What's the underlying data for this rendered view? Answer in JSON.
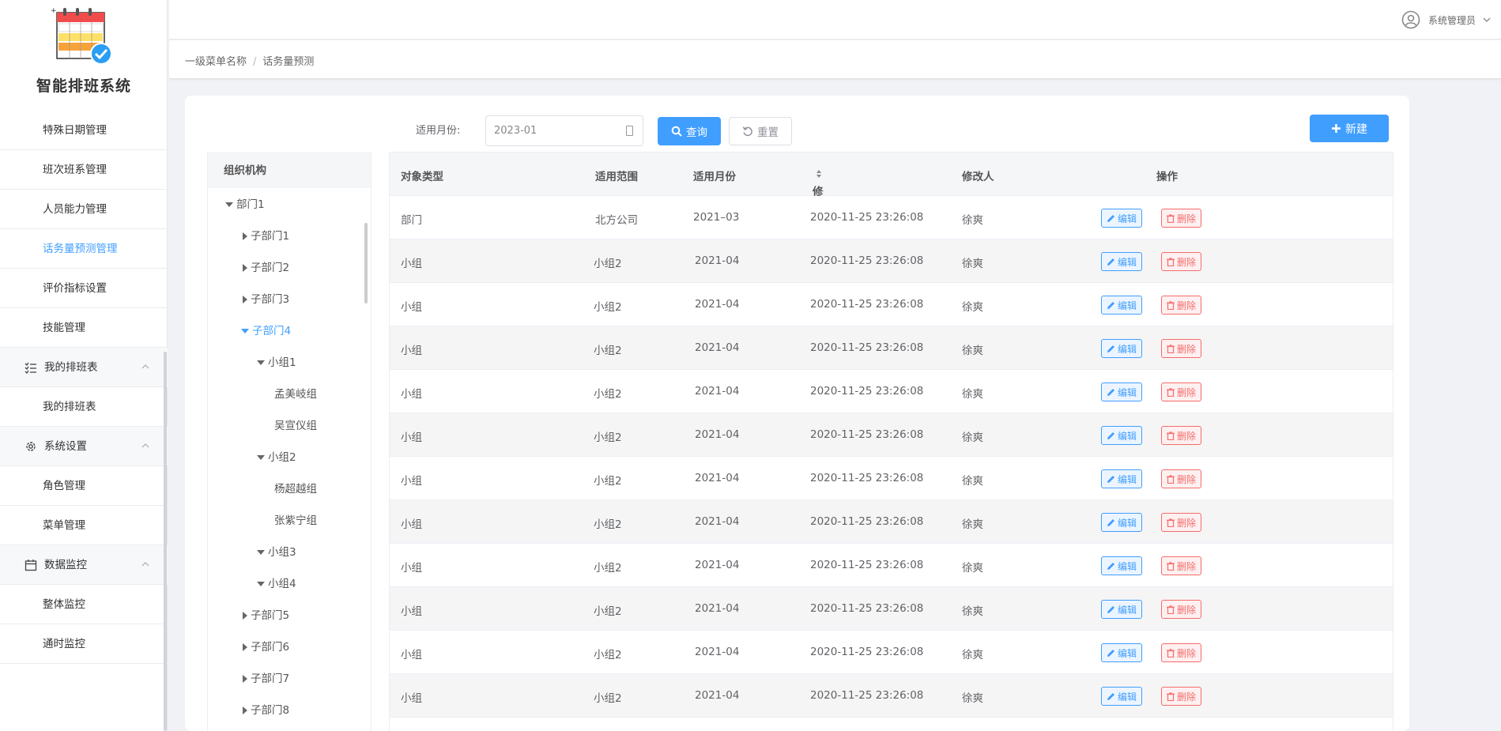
{
  "app": {
    "title": "智能排班系统"
  },
  "sidebar": {
    "items": [
      {
        "label": "特殊日期管理",
        "active": false
      },
      {
        "label": "班次班系管理",
        "active": false
      },
      {
        "label": "人员能力管理",
        "active": false
      },
      {
        "label": "话务量预测管理",
        "active": true
      },
      {
        "label": "评价指标设置",
        "active": false
      },
      {
        "label": "技能管理",
        "active": false
      }
    ],
    "groups": [
      {
        "label": "我的排班表",
        "icon": "list-check-icon",
        "children": [
          "我的排班表"
        ]
      },
      {
        "label": "系统设置",
        "icon": "gear-icon",
        "children": [
          "角色管理",
          "菜单管理"
        ]
      },
      {
        "label": "数据监控",
        "icon": "calendar-icon",
        "children": [
          "整体监控",
          "通时监控"
        ]
      }
    ]
  },
  "header": {
    "user_name": "系统管理员"
  },
  "breadcrumb": {
    "level1": "一级菜单名称",
    "separator": "/",
    "level2": "话务量预测"
  },
  "filter": {
    "month_label": "适用月份:",
    "month_value": "2023-01",
    "query_label": "查询",
    "reset_label": "重置",
    "new_label": "新建"
  },
  "tree": {
    "header": "组织机构",
    "nodes": [
      {
        "label": "部门1",
        "expanded": true
      },
      {
        "label": "子部门1"
      },
      {
        "label": "子部门2"
      },
      {
        "label": "子部门3"
      },
      {
        "label": "子部门4",
        "expanded": true,
        "active": true
      },
      {
        "label": "小组1",
        "expanded": true
      },
      {
        "label": "孟美岐组"
      },
      {
        "label": "吴宣仪组"
      },
      {
        "label": "小组2",
        "expanded": true
      },
      {
        "label": "杨超越组"
      },
      {
        "label": "张紫宁组"
      },
      {
        "label": "小组3",
        "expanded": true
      },
      {
        "label": "小组4",
        "expanded": true
      },
      {
        "label": "子部门5"
      },
      {
        "label": "子部门6"
      },
      {
        "label": "子部门7"
      },
      {
        "label": "子部门8"
      }
    ]
  },
  "table": {
    "columns": [
      "对象类型",
      "适用范围",
      "适用月份",
      "修改时间",
      "修改人",
      "操作"
    ],
    "edit_label": "编辑",
    "delete_label": "删除",
    "rows": [
      [
        "部门",
        "北方公司",
        "2021–03",
        "2020-11-25 23:26:08",
        "徐爽"
      ],
      [
        "小组",
        "小组2",
        "2021-04",
        "2020-11-25 23:26:08",
        "徐爽"
      ],
      [
        "小组",
        "小组2",
        "2021-04",
        "2020-11-25 23:26:08",
        "徐爽"
      ],
      [
        "小组",
        "小组2",
        "2021-04",
        "2020-11-25 23:26:08",
        "徐爽"
      ],
      [
        "小组",
        "小组2",
        "2021-04",
        "2020-11-25 23:26:08",
        "徐爽"
      ],
      [
        "小组",
        "小组2",
        "2021-04",
        "2020-11-25 23:26:08",
        "徐爽"
      ],
      [
        "小组",
        "小组2",
        "2021-04",
        "2020-11-25 23:26:08",
        "徐爽"
      ],
      [
        "小组",
        "小组2",
        "2021-04",
        "2020-11-25 23:26:08",
        "徐爽"
      ],
      [
        "小组",
        "小组2",
        "2021-04",
        "2020-11-25 23:26:08",
        "徐爽"
      ],
      [
        "小组",
        "小组2",
        "2021-04",
        "2020-11-25 23:26:08",
        "徐爽"
      ],
      [
        "小组",
        "小组2",
        "2021-04",
        "2020-11-25 23:26:08",
        "徐爽"
      ],
      [
        "小组",
        "小组2",
        "2021-04",
        "2020-11-25 23:26:08",
        "徐爽"
      ]
    ]
  },
  "colors": {
    "primary": "#409eff",
    "danger": "#f56c6c"
  }
}
